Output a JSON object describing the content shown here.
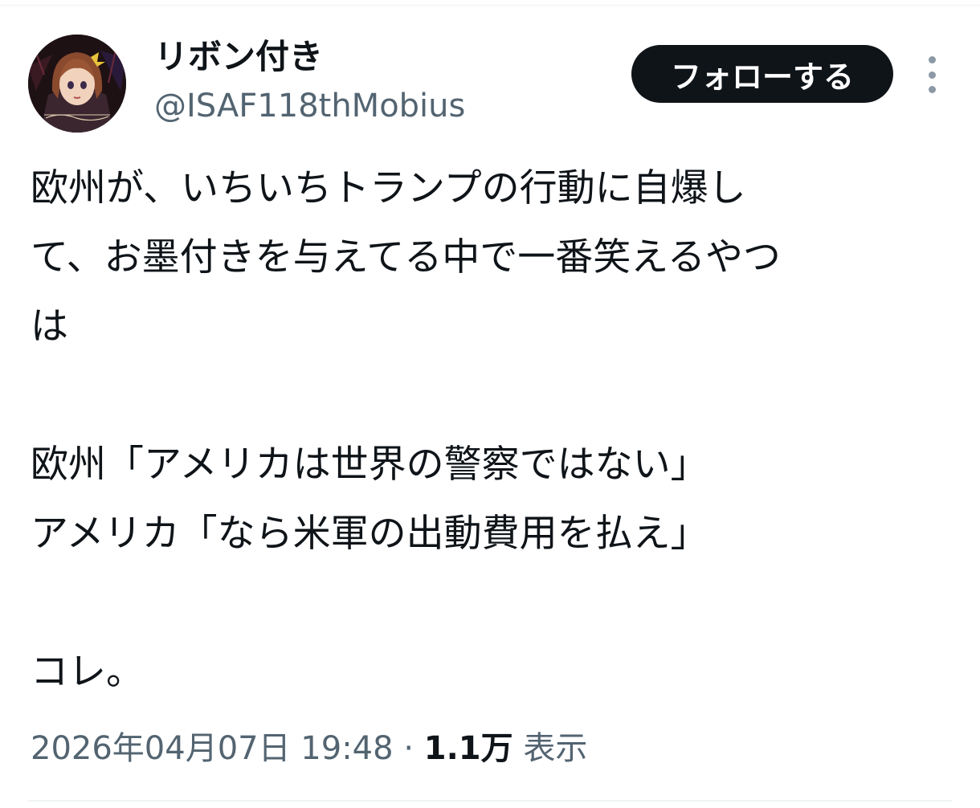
{
  "user": {
    "display_name": "リボン付き",
    "handle": "@ISAF118thMobius",
    "avatar_icon": "profile-avatar"
  },
  "actions": {
    "follow_label": "フォローする",
    "more_icon": "more-vertical-icon"
  },
  "tweet": {
    "lines": [
      "欧州が、いちいちトランプの行動に自爆し",
      "て、お墨付きを与えてる中で一番笑えるやつ",
      "は",
      "",
      "欧州「アメリカは世界の警察ではない」",
      "アメリカ「なら米軍の出動費用を払え」",
      "",
      "コレ。"
    ]
  },
  "meta": {
    "timestamp": "2026年04月07日 19:48",
    "separator": "·",
    "views_count": "1.1万",
    "views_label": "表示"
  },
  "colors": {
    "text_primary": "#0f1419",
    "text_secondary": "#536471",
    "button_bg": "#0f1419",
    "button_text": "#ffffff",
    "divider": "#eff3f4"
  }
}
